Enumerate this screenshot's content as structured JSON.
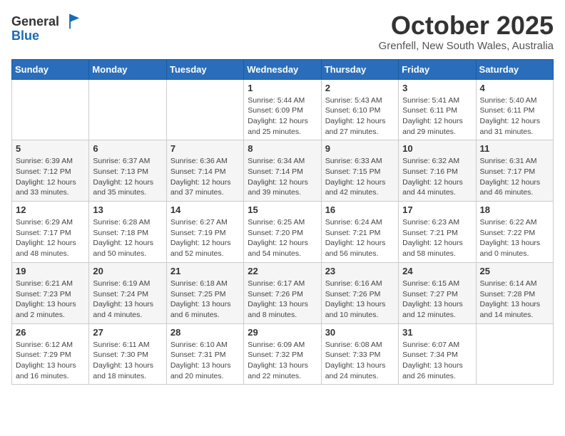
{
  "header": {
    "logo_line1": "General",
    "logo_line2": "Blue",
    "month_title": "October 2025",
    "location": "Grenfell, New South Wales, Australia"
  },
  "weekdays": [
    "Sunday",
    "Monday",
    "Tuesday",
    "Wednesday",
    "Thursday",
    "Friday",
    "Saturday"
  ],
  "weeks": [
    [
      {
        "day": "",
        "info": ""
      },
      {
        "day": "",
        "info": ""
      },
      {
        "day": "",
        "info": ""
      },
      {
        "day": "1",
        "info": "Sunrise: 5:44 AM\nSunset: 6:09 PM\nDaylight: 12 hours\nand 25 minutes."
      },
      {
        "day": "2",
        "info": "Sunrise: 5:43 AM\nSunset: 6:10 PM\nDaylight: 12 hours\nand 27 minutes."
      },
      {
        "day": "3",
        "info": "Sunrise: 5:41 AM\nSunset: 6:11 PM\nDaylight: 12 hours\nand 29 minutes."
      },
      {
        "day": "4",
        "info": "Sunrise: 5:40 AM\nSunset: 6:11 PM\nDaylight: 12 hours\nand 31 minutes."
      }
    ],
    [
      {
        "day": "5",
        "info": "Sunrise: 6:39 AM\nSunset: 7:12 PM\nDaylight: 12 hours\nand 33 minutes."
      },
      {
        "day": "6",
        "info": "Sunrise: 6:37 AM\nSunset: 7:13 PM\nDaylight: 12 hours\nand 35 minutes."
      },
      {
        "day": "7",
        "info": "Sunrise: 6:36 AM\nSunset: 7:14 PM\nDaylight: 12 hours\nand 37 minutes."
      },
      {
        "day": "8",
        "info": "Sunrise: 6:34 AM\nSunset: 7:14 PM\nDaylight: 12 hours\nand 39 minutes."
      },
      {
        "day": "9",
        "info": "Sunrise: 6:33 AM\nSunset: 7:15 PM\nDaylight: 12 hours\nand 42 minutes."
      },
      {
        "day": "10",
        "info": "Sunrise: 6:32 AM\nSunset: 7:16 PM\nDaylight: 12 hours\nand 44 minutes."
      },
      {
        "day": "11",
        "info": "Sunrise: 6:31 AM\nSunset: 7:17 PM\nDaylight: 12 hours\nand 46 minutes."
      }
    ],
    [
      {
        "day": "12",
        "info": "Sunrise: 6:29 AM\nSunset: 7:17 PM\nDaylight: 12 hours\nand 48 minutes."
      },
      {
        "day": "13",
        "info": "Sunrise: 6:28 AM\nSunset: 7:18 PM\nDaylight: 12 hours\nand 50 minutes."
      },
      {
        "day": "14",
        "info": "Sunrise: 6:27 AM\nSunset: 7:19 PM\nDaylight: 12 hours\nand 52 minutes."
      },
      {
        "day": "15",
        "info": "Sunrise: 6:25 AM\nSunset: 7:20 PM\nDaylight: 12 hours\nand 54 minutes."
      },
      {
        "day": "16",
        "info": "Sunrise: 6:24 AM\nSunset: 7:21 PM\nDaylight: 12 hours\nand 56 minutes."
      },
      {
        "day": "17",
        "info": "Sunrise: 6:23 AM\nSunset: 7:21 PM\nDaylight: 12 hours\nand 58 minutes."
      },
      {
        "day": "18",
        "info": "Sunrise: 6:22 AM\nSunset: 7:22 PM\nDaylight: 13 hours\nand 0 minutes."
      }
    ],
    [
      {
        "day": "19",
        "info": "Sunrise: 6:21 AM\nSunset: 7:23 PM\nDaylight: 13 hours\nand 2 minutes."
      },
      {
        "day": "20",
        "info": "Sunrise: 6:19 AM\nSunset: 7:24 PM\nDaylight: 13 hours\nand 4 minutes."
      },
      {
        "day": "21",
        "info": "Sunrise: 6:18 AM\nSunset: 7:25 PM\nDaylight: 13 hours\nand 6 minutes."
      },
      {
        "day": "22",
        "info": "Sunrise: 6:17 AM\nSunset: 7:26 PM\nDaylight: 13 hours\nand 8 minutes."
      },
      {
        "day": "23",
        "info": "Sunrise: 6:16 AM\nSunset: 7:26 PM\nDaylight: 13 hours\nand 10 minutes."
      },
      {
        "day": "24",
        "info": "Sunrise: 6:15 AM\nSunset: 7:27 PM\nDaylight: 13 hours\nand 12 minutes."
      },
      {
        "day": "25",
        "info": "Sunrise: 6:14 AM\nSunset: 7:28 PM\nDaylight: 13 hours\nand 14 minutes."
      }
    ],
    [
      {
        "day": "26",
        "info": "Sunrise: 6:12 AM\nSunset: 7:29 PM\nDaylight: 13 hours\nand 16 minutes."
      },
      {
        "day": "27",
        "info": "Sunrise: 6:11 AM\nSunset: 7:30 PM\nDaylight: 13 hours\nand 18 minutes."
      },
      {
        "day": "28",
        "info": "Sunrise: 6:10 AM\nSunset: 7:31 PM\nDaylight: 13 hours\nand 20 minutes."
      },
      {
        "day": "29",
        "info": "Sunrise: 6:09 AM\nSunset: 7:32 PM\nDaylight: 13 hours\nand 22 minutes."
      },
      {
        "day": "30",
        "info": "Sunrise: 6:08 AM\nSunset: 7:33 PM\nDaylight: 13 hours\nand 24 minutes."
      },
      {
        "day": "31",
        "info": "Sunrise: 6:07 AM\nSunset: 7:34 PM\nDaylight: 13 hours\nand 26 minutes."
      },
      {
        "day": "",
        "info": ""
      }
    ]
  ]
}
